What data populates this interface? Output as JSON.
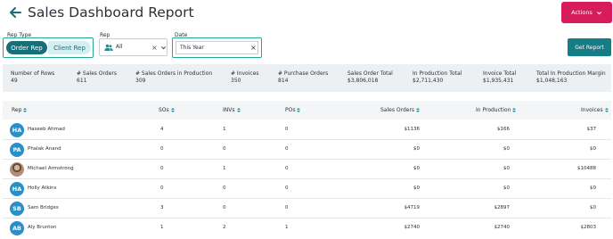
{
  "header": {
    "title": "Sales Dashboard Report",
    "actions_label": "Actions"
  },
  "filters": {
    "rep_type_label": "Rep Type",
    "rep_type_options": [
      "Order Rep",
      "Client Rep"
    ],
    "rep_type_selected": "Order Rep",
    "rep_label": "Rep",
    "rep_value": "All",
    "date_label": "Date",
    "date_value": "This Year",
    "get_report_label": "Get Report"
  },
  "summary": [
    {
      "label": "Number of Rows",
      "value": "49"
    },
    {
      "label": "# Sales Orders",
      "value": "611"
    },
    {
      "label": "# Sales Orders in Production",
      "value": "309"
    },
    {
      "label": "# Invoices",
      "value": "350"
    },
    {
      "label": "# Purchase Orders",
      "value": "814"
    },
    {
      "label": "Sales Order Total",
      "value": "$3,806,018"
    },
    {
      "label": "In Production Total",
      "value": "$2,711,430"
    },
    {
      "label": "Invoice Total",
      "value": "$1,935,431"
    },
    {
      "label": "Total In Production Margin",
      "value": "$1,048,163"
    }
  ],
  "table": {
    "columns": [
      "Rep",
      "SOs",
      "INVs",
      "POs",
      "Sales Orders",
      "In Production",
      "Invoices"
    ],
    "rows": [
      {
        "initials": "HA",
        "name": "Haseeb Ahmad",
        "sos": "4",
        "invs": "1",
        "pos": "0",
        "sales_orders": "$1136",
        "in_production": "$166",
        "invoices": "$37"
      },
      {
        "initials": "PA",
        "name": "Phalak Anand",
        "sos": "0",
        "invs": "0",
        "pos": "0",
        "sales_orders": "$0",
        "in_production": "$0",
        "invoices": "$0"
      },
      {
        "initials": "",
        "name": "Michael Armstrong",
        "sos": "0",
        "invs": "1",
        "pos": "0",
        "sales_orders": "$0",
        "in_production": "$0",
        "invoices": "$10488"
      },
      {
        "initials": "HA",
        "name": "Holly Atkins",
        "sos": "0",
        "invs": "0",
        "pos": "0",
        "sales_orders": "$0",
        "in_production": "$0",
        "invoices": "$0"
      },
      {
        "initials": "SB",
        "name": "Sam Bridges",
        "sos": "3",
        "invs": "0",
        "pos": "0",
        "sales_orders": "$4719",
        "in_production": "$2897",
        "invoices": "$0"
      },
      {
        "initials": "AB",
        "name": "Aly Brunton",
        "sos": "1",
        "invs": "2",
        "pos": "1",
        "sales_orders": "$2740",
        "in_production": "$2740",
        "invoices": "$2803"
      }
    ]
  },
  "colors": {
    "brand_pink": "#d81b5b",
    "teal": "#157d86",
    "avatar_blue": "#2b8fc7",
    "highlight_green": "#22a98d"
  },
  "icons": [
    "arrow-left-icon",
    "chevron-down-icon",
    "users-icon",
    "close-icon",
    "sort-icon"
  ]
}
